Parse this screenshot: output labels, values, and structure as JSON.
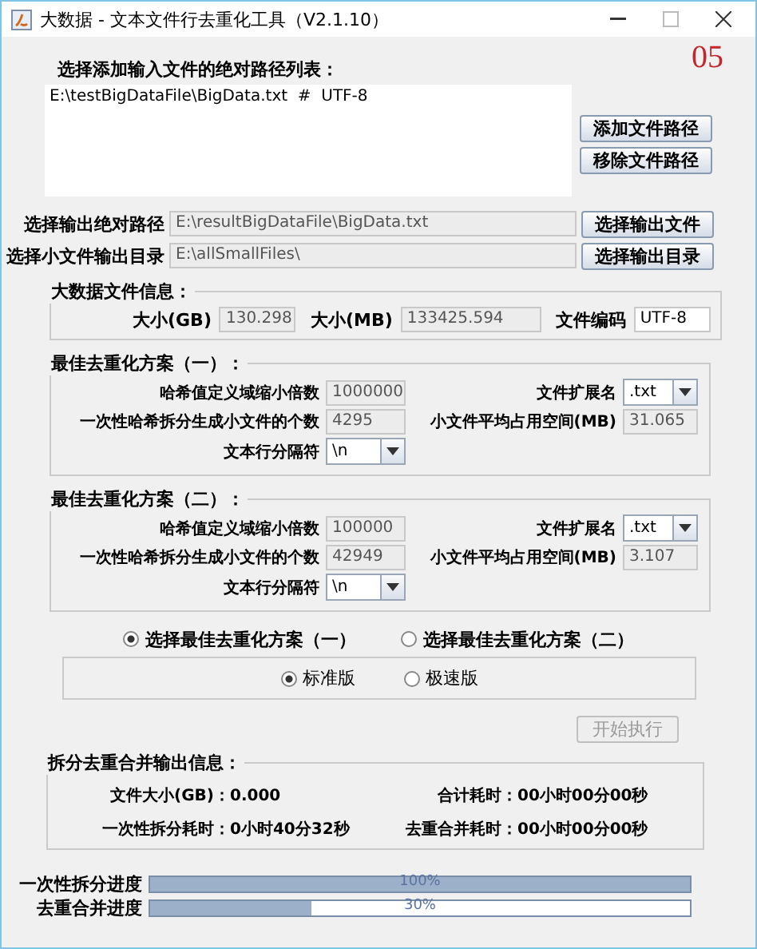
{
  "window": {
    "title": "大数据 - 文本文件行去重化工具（V2.1.10）",
    "badge": "05"
  },
  "input_list": {
    "label": "选择添加输入文件的绝对路径列表：",
    "items": [
      "E:\\testBigDataFile\\BigData.txt  #  UTF-8"
    ],
    "buttons": [
      "添加文件路径",
      "移除文件路径"
    ]
  },
  "output_rows": [
    {
      "label": "选择输出绝对路径",
      "value": "E:\\resultBigDataFile\\BigData.txt",
      "button": "选择输出文件"
    },
    {
      "label": "选择小文件输出目录",
      "value": "E:\\allSmallFiles\\",
      "button": "选择输出目录"
    }
  ],
  "file_info": {
    "title": "大数据文件信息：",
    "fields": [
      {
        "label": "大小(GB)",
        "value": "130.298",
        "editable": false
      },
      {
        "label": "大小(MB)",
        "value": "133425.594",
        "editable": false
      },
      {
        "label": "文件编码",
        "value": "UTF-8",
        "editable": true
      }
    ]
  },
  "schemes": [
    {
      "title": "最佳去重化方案（一）：",
      "factor_label": "哈希值定义域缩小倍数",
      "factor": "1000000",
      "ext_label": "文件扩展名",
      "ext": ".txt",
      "count_label": "一次性哈希拆分生成小文件的个数",
      "count": "4295",
      "avg_label": "小文件平均占用空间(MB)",
      "avg": "31.065",
      "sep_label": "文本行分隔符",
      "sep": "\\n"
    },
    {
      "title": "最佳去重化方案（二）：",
      "factor_label": "哈希值定义域缩小倍数",
      "factor": "100000",
      "ext_label": "文件扩展名",
      "ext": ".txt",
      "count_label": "一次性哈希拆分生成小文件的个数",
      "count": "42949",
      "avg_label": "小文件平均占用空间(MB)",
      "avg": "3.107",
      "sep_label": "文本行分隔符",
      "sep": "\\n"
    }
  ],
  "scheme_choice": [
    {
      "label": "选择最佳去重化方案（一）",
      "selected": true
    },
    {
      "label": "选择最佳去重化方案（二）",
      "selected": false
    }
  ],
  "edition": [
    {
      "label": "标准版",
      "selected": true
    },
    {
      "label": "极速版",
      "selected": false
    }
  ],
  "execute_button": {
    "label": "开始执行",
    "disabled": true
  },
  "output_info": {
    "title": "拆分去重合并输出信息：",
    "items": [
      {
        "label": "文件大小(GB)：",
        "value": "0.000"
      },
      {
        "label": "合计耗时：",
        "value": "00小时00分00秒"
      },
      {
        "label": "一次性拆分耗时：",
        "value": "0小时40分32秒"
      },
      {
        "label": "去重合并耗时：",
        "value": "00小时00分00秒"
      }
    ]
  },
  "progress": [
    {
      "label": "一次性拆分进度",
      "level": 1.0,
      "reading": "100%"
    },
    {
      "label": "去重合并进度",
      "level": 0.3,
      "reading": "30%"
    }
  ]
}
